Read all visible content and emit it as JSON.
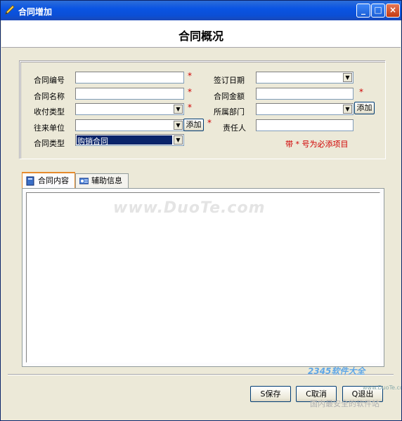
{
  "window": {
    "title": "合同增加",
    "minimize": "_",
    "maximize": "□",
    "close": "×"
  },
  "header": {
    "title": "合同概况"
  },
  "form": {
    "contract_no_label": "合同编号",
    "contract_name_label": "合同名称",
    "payment_type_label": "收付类型",
    "partner_label": "往来单位",
    "contract_type_label": "合同类型",
    "contract_type_value": "购销合同",
    "sign_date_label": "签订日期",
    "amount_label": "合同金额",
    "department_label": "所属部门",
    "responsible_label": "责任人",
    "add_label": "添加",
    "required_mark": "*",
    "required_hint": "带 * 号为必添项目"
  },
  "tabs": [
    {
      "label": "合同内容"
    },
    {
      "label": "辅助信息"
    }
  ],
  "footer": {
    "save": "S保存",
    "cancel": "C取消",
    "exit": "Q退出"
  },
  "watermark": {
    "text": "www.DuoTe.com",
    "logo": "2345软件大全",
    "logo_url": "www.DuoTe.com",
    "logo_sub": "国内最安全的软件站"
  }
}
